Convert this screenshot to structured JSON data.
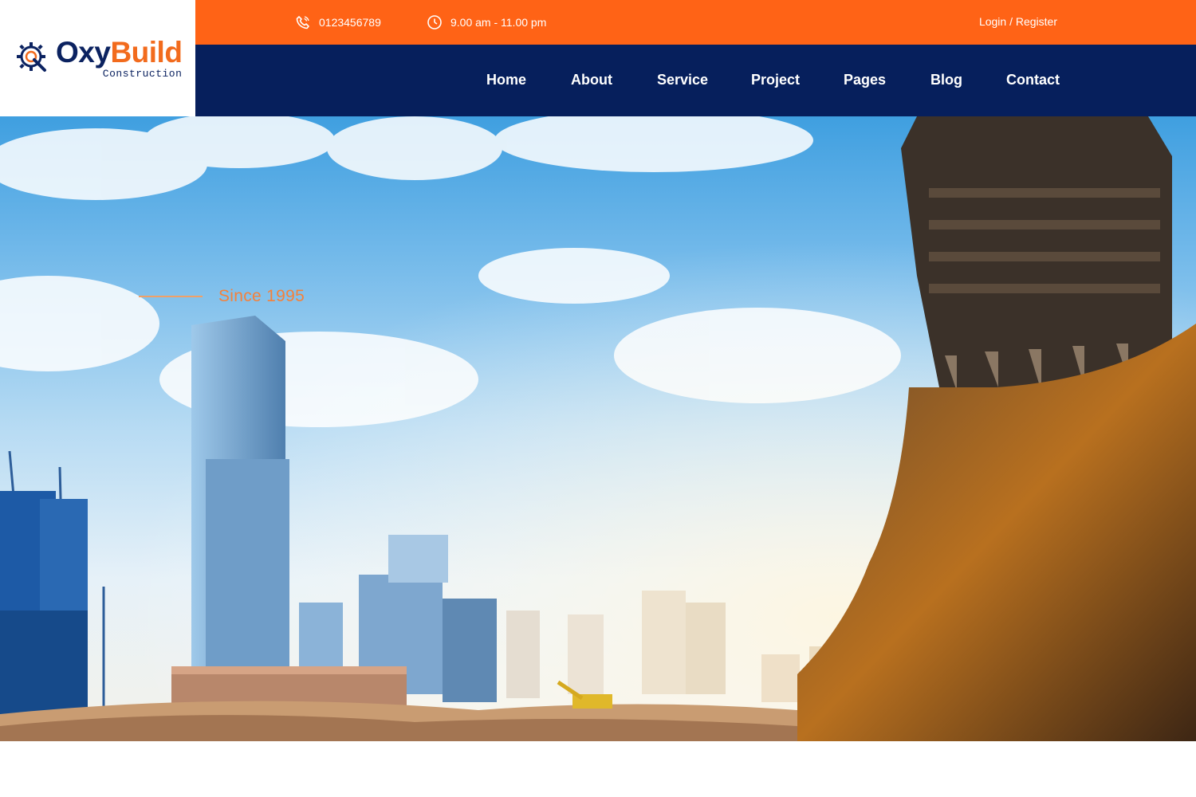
{
  "brand": {
    "name_part1": "Oxy",
    "name_part2": "Build",
    "tagline": "Construction",
    "primary_color": "#061f5c",
    "accent_color": "#ff6316",
    "logo_icon": "gear-magnifier-icon"
  },
  "topbar": {
    "phone": "0123456789",
    "phone_icon": "phone-icon",
    "hours": "9.00 am - 11.00 pm",
    "hours_icon": "clock-icon",
    "login_register": "Login / Register"
  },
  "nav": {
    "items": [
      {
        "label": "Home"
      },
      {
        "label": "About"
      },
      {
        "label": "Service"
      },
      {
        "label": "Project"
      },
      {
        "label": "Pages"
      },
      {
        "label": "Blog"
      },
      {
        "label": "Contact"
      }
    ]
  },
  "hero": {
    "since_label": "Since 1995"
  }
}
